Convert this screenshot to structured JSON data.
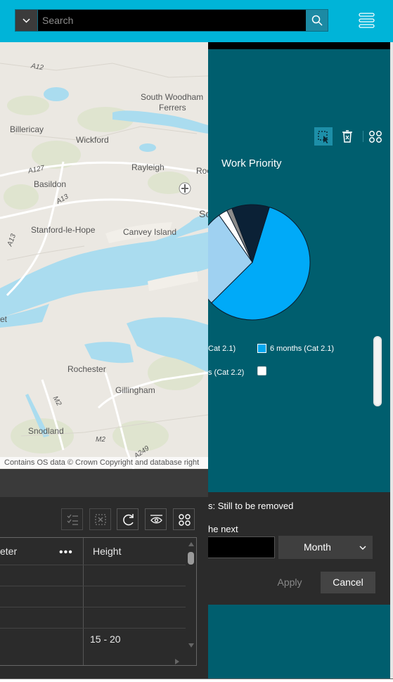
{
  "search": {
    "placeholder": "Search"
  },
  "map": {
    "attribution": "Contains OS data © Crown Copyright and database right",
    "places": [
      {
        "name": "A12",
        "italic": true
      },
      {
        "name": "South Woodham",
        "italic": false
      },
      {
        "name": "Ferrers",
        "italic": false
      },
      {
        "name": "Billericay",
        "italic": false
      },
      {
        "name": "Wickford",
        "italic": false
      },
      {
        "name": "A127",
        "italic": true
      },
      {
        "name": "Rayleigh",
        "italic": false
      },
      {
        "name": "Roc",
        "italic": false
      },
      {
        "name": "Basildon",
        "italic": false
      },
      {
        "name": "A13",
        "italic": true
      },
      {
        "name": "So",
        "italic": false
      },
      {
        "name": "Stanford-le-Hope",
        "italic": false
      },
      {
        "name": "Canvey Island",
        "italic": false
      },
      {
        "name": "A13",
        "italic": true
      },
      {
        "name": "et",
        "italic": false
      },
      {
        "name": "Rochester",
        "italic": false
      },
      {
        "name": "Gillingham",
        "italic": false
      },
      {
        "name": "M2",
        "italic": true
      },
      {
        "name": "Snodland",
        "italic": false
      },
      {
        "name": "M2",
        "italic": true
      },
      {
        "name": "A249",
        "italic": true
      }
    ]
  },
  "widget": {
    "chart_title": "Work Priority",
    "legend": [
      {
        "label": "Cat 2.1)",
        "color": "#0a2036"
      },
      {
        "label": "6 months (Cat 2.1)",
        "color": "#00a8f0"
      },
      {
        "label": "s (Cat 2.2)",
        "color": "#0a2036"
      },
      {
        "label": "",
        "color": "#ffffff"
      }
    ]
  },
  "chart_data": {
    "type": "pie",
    "title": "Work Priority",
    "slices": [
      {
        "label": "6 months (Cat 2.1)",
        "value": 57.5,
        "color": "#00aaf8"
      },
      {
        "label": "",
        "value": 27.5,
        "color": "#9fd1f1"
      },
      {
        "label": "",
        "value": 2.5,
        "color": "#ffffff"
      },
      {
        "label": "",
        "value": 1.5,
        "color": "#8b8b8b"
      },
      {
        "label": "",
        "value": 10.5,
        "color": "#0b2136"
      }
    ]
  },
  "table": {
    "columns": [
      "eter",
      "Height"
    ],
    "rows": [
      {
        "c1": "",
        "c2": ""
      },
      {
        "c1": "",
        "c2": ""
      },
      {
        "c1": "",
        "c2": ""
      },
      {
        "c1": "",
        "c2": "15 - 20"
      }
    ]
  },
  "filter": {
    "status_text": "s: Still to be removed",
    "next_text": "he next",
    "period_value": "Month",
    "apply_label": "Apply",
    "cancel_label": "Cancel"
  }
}
